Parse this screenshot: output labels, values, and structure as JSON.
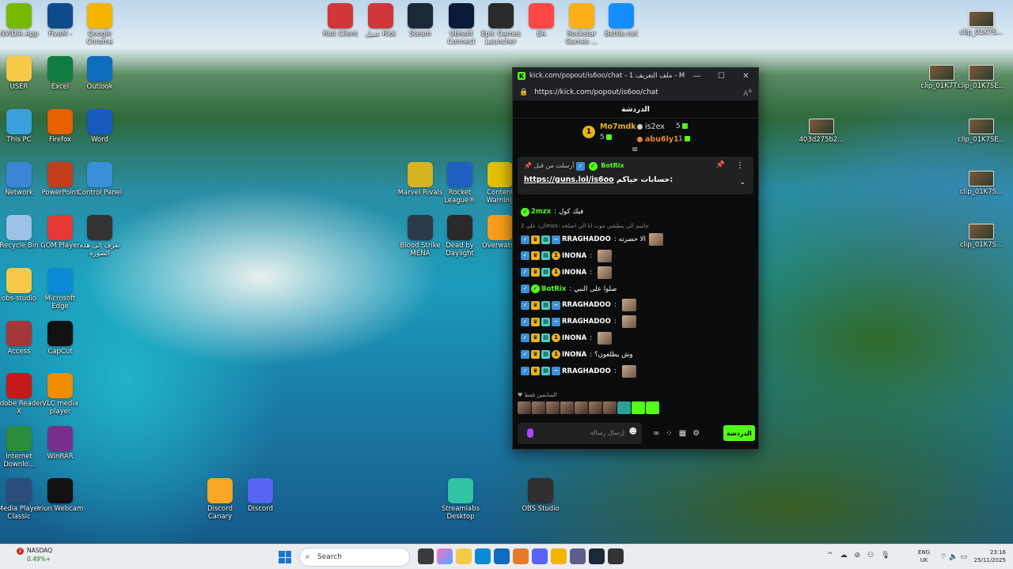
{
  "desktop_icons_left": [
    {
      "label": "NVIDIA App",
      "icon": "nvidia-icon",
      "color": "#76b900"
    },
    {
      "label": "FiveM -",
      "icon": "fivem-icon",
      "color": "#0f4a8c"
    },
    {
      "label": "Google Chrome",
      "icon": "chrome-icon",
      "color": "#f4b400"
    },
    {
      "label": "USER",
      "icon": "folder-icon",
      "color": "#f7c948"
    },
    {
      "label": "Excel",
      "icon": "excel-icon",
      "color": "#107c41"
    },
    {
      "label": "Outlook",
      "icon": "outlook-icon",
      "color": "#0f6cbd"
    },
    {
      "label": "This PC",
      "icon": "pc-icon",
      "color": "#39a0dc"
    },
    {
      "label": "Firefox",
      "icon": "firefox-icon",
      "color": "#e66000"
    },
    {
      "label": "Word",
      "icon": "word-icon",
      "color": "#185abd"
    },
    {
      "label": "Network",
      "icon": "network-icon",
      "color": "#3c84d6"
    },
    {
      "label": "PowerPoint",
      "icon": "powerpoint-icon",
      "color": "#c43e1c"
    },
    {
      "label": "Control Panel",
      "icon": "control-panel-icon",
      "color": "#3a8fd9"
    },
    {
      "label": "Recycle Bin",
      "icon": "recycle-bin-icon",
      "color": "#9cc3e5"
    },
    {
      "label": "GOM Player",
      "icon": "gom-player-icon",
      "color": "#e53935"
    },
    {
      "label": "تعرف إلى هذه الصورة",
      "icon": "camera-icon",
      "color": "#333333"
    },
    {
      "label": "obs-studio",
      "icon": "folder-icon",
      "color": "#f7c948"
    },
    {
      "label": "Microsoft Edge",
      "icon": "edge-icon",
      "color": "#0c8ad6"
    },
    {
      "label": "Access",
      "icon": "access-icon",
      "color": "#a4373a"
    },
    {
      "label": "CapCut",
      "icon": "capcut-icon",
      "color": "#111111"
    },
    {
      "label": "Adobe Reader X",
      "icon": "adobe-reader-icon",
      "color": "#c41a1a"
    },
    {
      "label": "VLC media player",
      "icon": "vlc-icon",
      "color": "#f08c00"
    },
    {
      "label": "Internet Downlo...",
      "icon": "idm-icon",
      "color": "#2a8c3c"
    },
    {
      "label": "WinRAR",
      "icon": "winrar-icon",
      "color": "#7a2f8c"
    },
    {
      "label": "Media Player Classic",
      "icon": "mpc-icon",
      "color": "#2b4d7a"
    },
    {
      "label": "Iriun Webcam",
      "icon": "iriun-icon",
      "color": "#111111"
    }
  ],
  "desktop_icons_top": [
    {
      "label": "Riot Client",
      "icon": "riot-icon",
      "color": "#d13639"
    },
    {
      "label": "عميل Riot",
      "icon": "riot-icon",
      "color": "#d13639"
    },
    {
      "label": "Steam",
      "icon": "steam-icon",
      "color": "#1b2838"
    },
    {
      "label": "Ubisoft Connect",
      "icon": "ubisoft-icon",
      "color": "#0b1a3a"
    },
    {
      "label": "Epic Games Launcher",
      "icon": "epic-icon",
      "color": "#2a2a2a"
    },
    {
      "label": "EA",
      "icon": "ea-icon",
      "color": "#ff4747"
    },
    {
      "label": "Rockstar Games ...",
      "icon": "rockstar-icon",
      "color": "#fcaf17"
    },
    {
      "label": "Battle.net",
      "icon": "battlenet-icon",
      "color": "#148eff"
    }
  ],
  "desktop_icons_middle": [
    {
      "label": "Marvel Rivals",
      "icon": "marvel-rivals-icon",
      "color": "#d6b320"
    },
    {
      "label": "Rocket League®",
      "icon": "rocket-league-icon",
      "color": "#1f5fbf"
    },
    {
      "label": "Content Warning",
      "icon": "content-warning-icon",
      "color": "#e2c000"
    },
    {
      "label": "Blood Strike MENA",
      "icon": "blood-strike-icon",
      "color": "#2c3a4a"
    },
    {
      "label": "Dead by Daylight",
      "icon": "dbd-icon",
      "color": "#2a2a2a"
    },
    {
      "label": "Overwatch",
      "icon": "overwatch-icon",
      "color": "#f99e1a"
    }
  ],
  "desktop_icons_bottom": [
    {
      "label": "Discord Canary",
      "icon": "discord-canary-icon",
      "color": "#f9a825"
    },
    {
      "label": "Discord",
      "icon": "discord-icon",
      "color": "#5865f2"
    },
    {
      "label": "Streamlabs Desktop",
      "icon": "streamlabs-icon",
      "color": "#31c3a2"
    },
    {
      "label": "OBS Studio",
      "icon": "obs-icon",
      "color": "#302e31"
    }
  ],
  "desktop_icons_right": [
    {
      "label": "clip_01K7S...",
      "icon": "video-thumb-icon"
    },
    {
      "label": "clip_01K7T...",
      "icon": "video-thumb-icon"
    },
    {
      "label": "clip_01K7SE...",
      "icon": "video-thumb-icon"
    },
    {
      "label": "403d275b2...",
      "icon": "video-thumb-icon"
    },
    {
      "label": "clip_01K7SE...",
      "icon": "video-thumb-icon"
    },
    {
      "label": "clip_01K7S...",
      "icon": "video-thumb-icon"
    },
    {
      "label": "clip_01K7S...",
      "icon": "video-thumb-icon"
    }
  ],
  "popup": {
    "window_title": "kick.com/popout/is6oo/chat - 1 ‎ملف التعريف‎ - Microso...",
    "url": "https://kick.com/popout/is6oo/chat",
    "chat_header": "الدردشة",
    "leaderboard": {
      "first": {
        "name": "Mo7mdk",
        "count": "5",
        "rank": "1"
      },
      "second": {
        "name": "is2ex",
        "count": "5"
      },
      "third": {
        "name": "abu6ly1",
        "count": "1"
      }
    },
    "pinned": {
      "by_label": "أرسلت من قبل",
      "author": "BotRix",
      "text_prefix": "حسابات حياكم:",
      "link": "https://guns.lol/is6oo"
    },
    "messages": [
      {
        "user": "2mzx",
        "user_color": "#53fc18",
        "text": "فيك كول",
        "badges": [
          "green"
        ]
      },
      {
        "type": "reply",
        "text": "الرد على 2mzx: جاسم الي ينطشي موب انا الي اصلحه"
      },
      {
        "user": "RRAGHADOO",
        "user_color": "#ffffff",
        "text": "الا حضرته",
        "badges": [
          "blue",
          "gold",
          "cyan",
          "kick"
        ],
        "avatar": true
      },
      {
        "user": "INONA",
        "user_color": "#ffffff",
        "text": "",
        "badges": [
          "blue",
          "gold",
          "cyan",
          "one"
        ],
        "avatar": true
      },
      {
        "user": "INONA",
        "user_color": "#ffffff",
        "text": "",
        "badges": [
          "blue",
          "gold",
          "cyan",
          "one"
        ],
        "avatar": true
      },
      {
        "user": "BotRix",
        "user_color": "#53fc18",
        "text": "صلوا على النبي",
        "badges": [
          "blue",
          "green"
        ]
      },
      {
        "user": "RRAGHADOO",
        "user_color": "#ffffff",
        "text": "",
        "badges": [
          "blue",
          "gold",
          "cyan",
          "kick"
        ],
        "avatar": true
      },
      {
        "user": "RRAGHADOO",
        "user_color": "#ffffff",
        "text": "",
        "badges": [
          "blue",
          "gold",
          "cyan",
          "kick"
        ],
        "avatar": true
      },
      {
        "user": "INONA",
        "user_color": "#ffffff",
        "text": "",
        "badges": [
          "blue",
          "gold",
          "cyan",
          "one"
        ],
        "avatar": true
      },
      {
        "user": "INONA",
        "user_color": "#ffffff",
        "text": "وش يطلعون؟",
        "badges": [
          "blue",
          "gold",
          "cyan",
          "one"
        ]
      },
      {
        "user": "RRAGHADOO",
        "user_color": "#ffffff",
        "text": "",
        "badges": [
          "blue",
          "gold",
          "cyan",
          "kick"
        ],
        "avatar": true
      }
    ],
    "emote_section_title": "المتابعين فقط",
    "input_placeholder": "إرسال رسالة",
    "send_label": "الدردشة"
  },
  "taskbar": {
    "stock_name": "NASDAQ",
    "stock_change": "0.49%+",
    "notif_count": "2",
    "search_placeholder": "Search",
    "lang_top": "ENG",
    "lang_bottom": "UK",
    "time": "23:16",
    "date": "25/11/2025"
  }
}
